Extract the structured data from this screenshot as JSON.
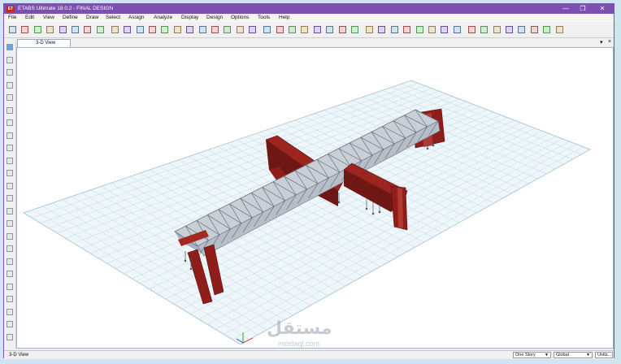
{
  "app": {
    "logo": "ET",
    "title": "ETABS Ultimate 18.0.2 - FINAL DESIGN"
  },
  "window_controls": {
    "minimize": "—",
    "maximize": "❐",
    "close": "✕"
  },
  "menu": [
    "File",
    "Edit",
    "View",
    "Define",
    "Draw",
    "Select",
    "Assign",
    "Analyze",
    "Display",
    "Design",
    "Options",
    "Tools",
    "Help"
  ],
  "view_tab": {
    "label": "3-D View",
    "dropdown_glyph": "▾",
    "close_glyph": "×"
  },
  "status": {
    "view_label": "3-D View",
    "story": "One Story",
    "coord_system": "Global",
    "units_button": "Units..."
  },
  "watermark": {
    "text": "مستقل",
    "sub": "mostaql.com"
  },
  "colors": {
    "titlebar": "#7c4fb0",
    "grid": "#a9c7d6",
    "steel": "#8e9aa8",
    "column": "#8f1d1a"
  }
}
